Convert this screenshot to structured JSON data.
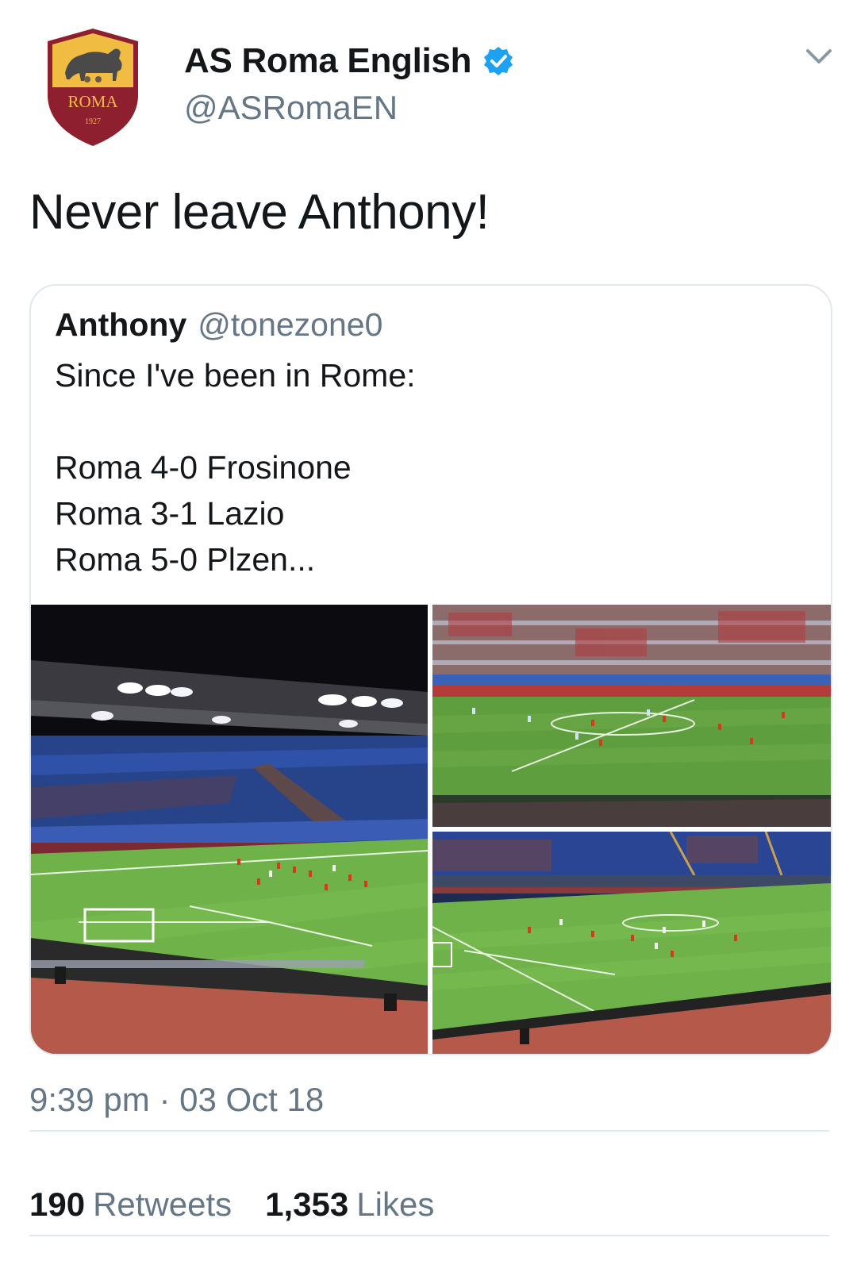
{
  "account": {
    "display_name": "AS Roma English",
    "handle": "@ASRomaEN",
    "verified": true,
    "avatar_text": "ROMA",
    "avatar_year": "1927"
  },
  "tweet": {
    "text": "Never leave Anthony!"
  },
  "quoted_tweet": {
    "name": "Anthony",
    "handle": "@tonezone0",
    "lines": [
      "Since I've been in Rome:",
      "",
      "Roma 4-0 Frosinone",
      "Roma 3-1 Lazio",
      "Roma 5-0 Plzen..."
    ],
    "photos": [
      "stadium-night-photo",
      "stadium-day-photo",
      "stadium-evening-photo"
    ]
  },
  "meta": {
    "time": "9:39 pm",
    "separator": "·",
    "date": "03 Oct 18"
  },
  "stats": {
    "retweets_count": "190",
    "retweets_label": "Retweets",
    "likes_count": "1,353",
    "likes_label": "Likes"
  },
  "colors": {
    "primary_text": "#14171a",
    "secondary_text": "#657786",
    "border": "#e1e8ed",
    "verified_blue": "#1da1f2",
    "roma_red": "#8e1f2f",
    "roma_yellow": "#f0bc42"
  },
  "icons": {
    "verified": "verified-badge-icon",
    "menu": "chevron-down-icon"
  }
}
